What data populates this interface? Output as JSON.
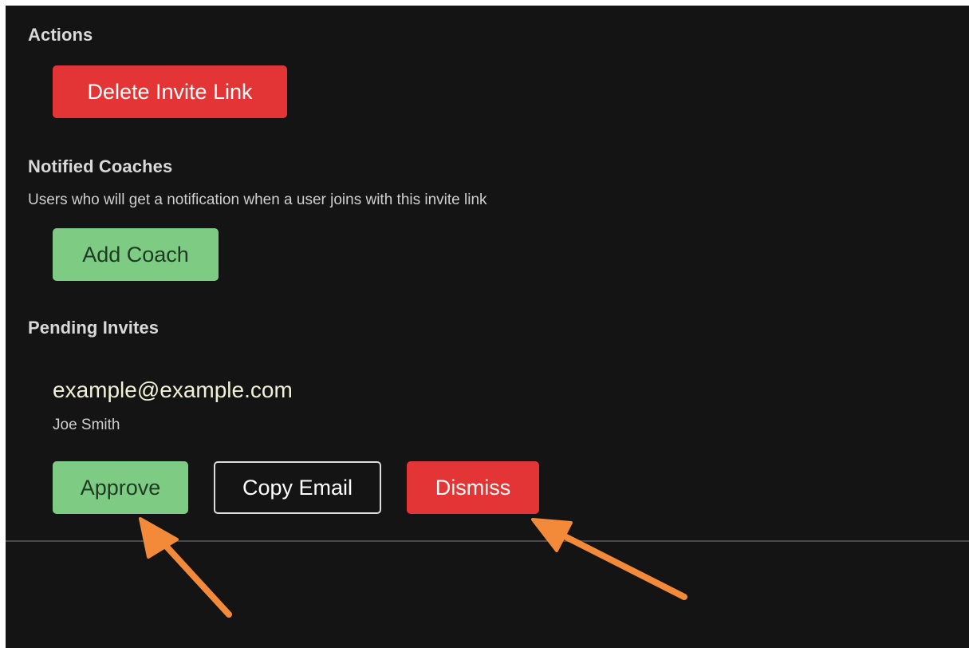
{
  "sections": {
    "actions": {
      "title": "Actions",
      "delete_invite_link_label": "Delete Invite Link"
    },
    "notified_coaches": {
      "title": "Notified Coaches",
      "description": "Users who will get a notification when a user joins with this invite link",
      "add_coach_label": "Add Coach"
    },
    "pending_invites": {
      "title": "Pending Invites",
      "invite": {
        "email": "example@example.com",
        "name": "Joe Smith",
        "approve_label": "Approve",
        "copy_email_label": "Copy Email",
        "dismiss_label": "Dismiss"
      }
    }
  },
  "colors": {
    "background": "#141414",
    "danger": "#e33535",
    "success": "#7ecb83",
    "annotation_arrow": "#f28a3a"
  }
}
